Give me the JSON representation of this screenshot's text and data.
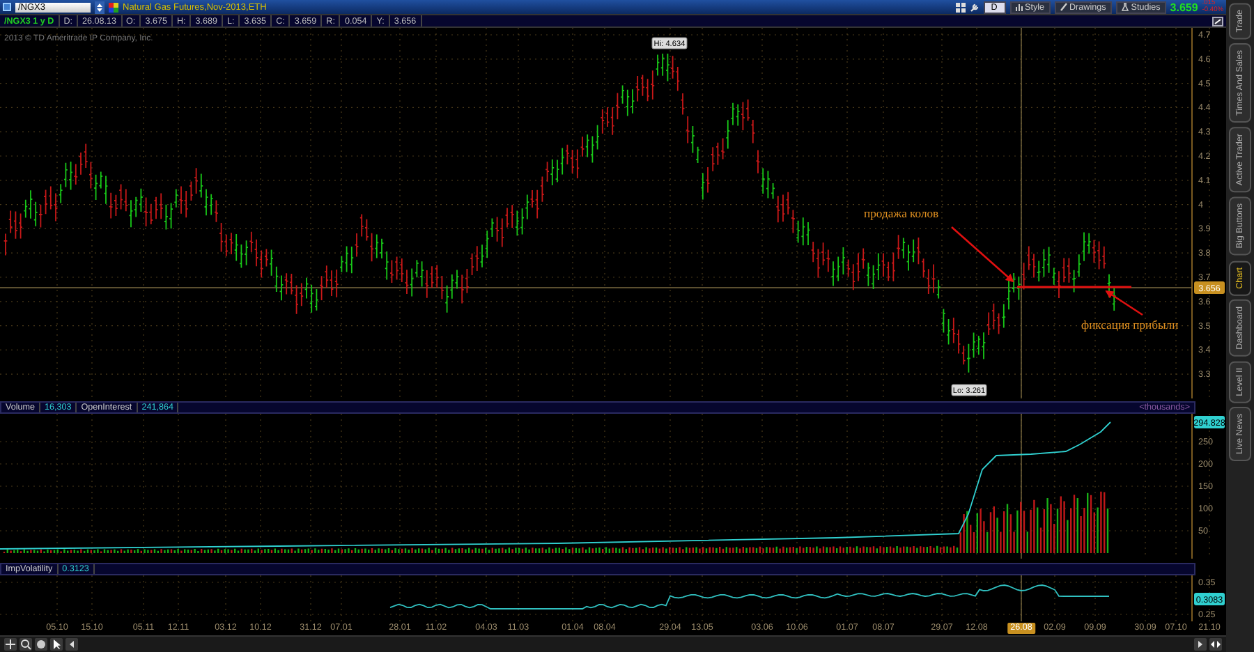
{
  "toolbar": {
    "symbol": "/NGX3",
    "title": "Natural Gas Futures,Nov-2013,ETH",
    "period_button": "D",
    "buttons": [
      {
        "label": "Style"
      },
      {
        "label": "Drawings"
      },
      {
        "label": "Studies"
      }
    ],
    "last_price": "3.659",
    "net_change": ".015",
    "percent_change": "-0.40%"
  },
  "info_bar": {
    "chart_label": "/NGX3 1 y D",
    "fields": [
      {
        "label": "D:",
        "value": "26.08.13"
      },
      {
        "label": "O:",
        "value": "3.675"
      },
      {
        "label": "H:",
        "value": "3.689"
      },
      {
        "label": "L:",
        "value": "3.635"
      },
      {
        "label": "C:",
        "value": "3.659"
      },
      {
        "label": "R:",
        "value": "0.054"
      },
      {
        "label": "Y:",
        "value": "3.656"
      }
    ]
  },
  "price_panel": {
    "copyright": "2013 © TD Ameritrade IP Company, Inc.",
    "high_label": "Hi: 4.634",
    "low_label": "Lo: 3.261",
    "price_axis": [
      "4.7",
      "4.6",
      "4.5",
      "4.4",
      "4.3",
      "4.2",
      "4.1",
      "4",
      "3.9",
      "3.8",
      "3.7",
      "3.6",
      "3.5",
      "3.4",
      "3.3"
    ],
    "price_tag": "3.656",
    "annotations": [
      {
        "text": "продажа колов"
      },
      {
        "text": "фиксация прибыли"
      }
    ]
  },
  "volume_panel": {
    "fields": [
      {
        "label": "Volume",
        "value": "16,303"
      },
      {
        "label": "OpenInterest",
        "value": "241,864"
      }
    ],
    "units": "<thousands>",
    "axis": [
      "250",
      "200",
      "150",
      "100",
      "50"
    ],
    "value_tag": "294.828"
  },
  "volatility_panel": {
    "fields": [
      {
        "label": "ImpVolatility",
        "value": "0.3123"
      }
    ],
    "axis": [
      "0.35",
      "0.25"
    ],
    "value_tag": "0.3083"
  },
  "date_axis": [
    {
      "label": "05.10",
      "selected": false
    },
    {
      "label": "15.10",
      "selected": false
    },
    {
      "label": "05.11",
      "selected": false
    },
    {
      "label": "12.11",
      "selected": false
    },
    {
      "label": "03.12",
      "selected": false
    },
    {
      "label": "10.12",
      "selected": false
    },
    {
      "label": "31.12",
      "selected": false
    },
    {
      "label": "07.01",
      "selected": false
    },
    {
      "label": "28.01",
      "selected": false
    },
    {
      "label": "11.02",
      "selected": false
    },
    {
      "label": "04.03",
      "selected": false
    },
    {
      "label": "11.03",
      "selected": false
    },
    {
      "label": "01.04",
      "selected": false
    },
    {
      "label": "08.04",
      "selected": false
    },
    {
      "label": "29.04",
      "selected": false
    },
    {
      "label": "13.05",
      "selected": false
    },
    {
      "label": "03.06",
      "selected": false
    },
    {
      "label": "10.06",
      "selected": false
    },
    {
      "label": "01.07",
      "selected": false
    },
    {
      "label": "08.07",
      "selected": false
    },
    {
      "label": "29.07",
      "selected": false
    },
    {
      "label": "12.08",
      "selected": false
    },
    {
      "label": "26.08",
      "selected": true
    },
    {
      "label": "02.09",
      "selected": false
    },
    {
      "label": "09.09",
      "selected": false
    },
    {
      "label": "30.09",
      "selected": false
    },
    {
      "label": "07.10",
      "selected": false
    },
    {
      "label": "21.10",
      "selected": false
    }
  ],
  "side_tabs": [
    {
      "label": "Trade",
      "selected": false
    },
    {
      "label": "Times And Sales",
      "selected": false
    },
    {
      "label": "Active Trader",
      "selected": false
    },
    {
      "label": "Big Buttons",
      "selected": false
    },
    {
      "label": "Chart",
      "selected": true
    },
    {
      "label": "Dashboard",
      "selected": false
    },
    {
      "label": "Level II",
      "selected": false
    },
    {
      "label": "Live News",
      "selected": false
    }
  ]
}
